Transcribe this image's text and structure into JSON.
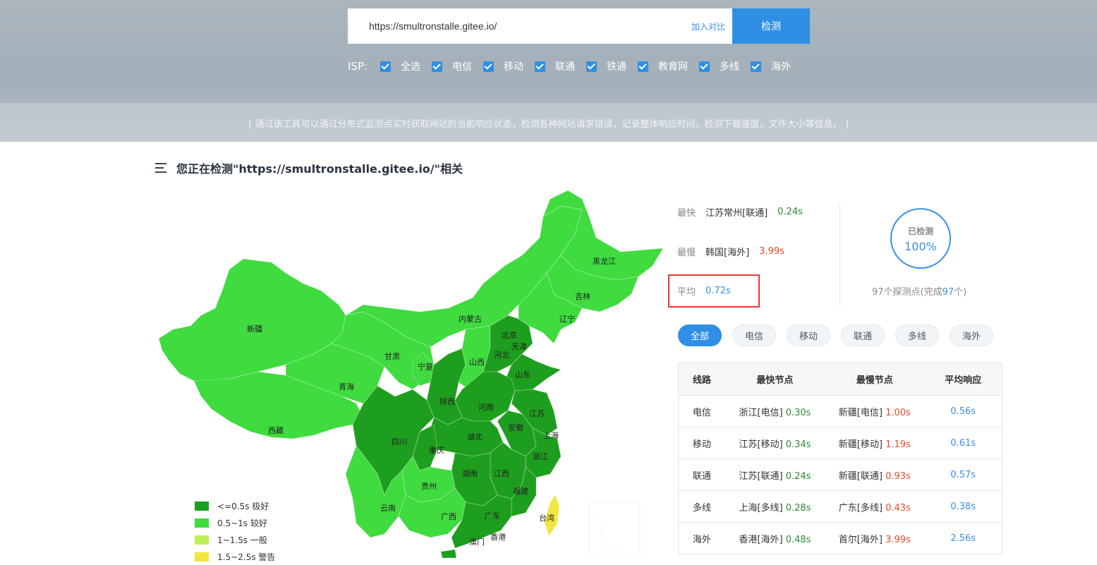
{
  "search": {
    "url_value": "https://smultronstalle.gitee.io/",
    "compare_label": "加入对比",
    "submit_label": "检测"
  },
  "isp_filter": {
    "label": "ISP:",
    "options": [
      "全选",
      "电信",
      "移动",
      "联通",
      "铁通",
      "教育网",
      "多线",
      "海外"
    ]
  },
  "notice": "[ 通过该工具可以通过分布式监测点实时获取网站的当前响应状态，检测各种网站请求错误，记录整体响应时间，检测下载速度，文件大小等信息。 ]",
  "section_title": "您正在检测\"https://smultronstalle.gitee.io/\"相关",
  "map": {
    "provinces": [
      "新疆",
      "西藏",
      "青海",
      "甘肃",
      "内蒙古",
      "黑龙江",
      "吉林",
      "辽宁",
      "北京",
      "天津",
      "河北",
      "宁夏",
      "山西",
      "山东",
      "陕西",
      "河南",
      "江苏",
      "上海",
      "安徽",
      "四川",
      "重庆",
      "湖北",
      "浙江",
      "湖南",
      "江西",
      "贵州",
      "福建",
      "云南",
      "广西",
      "广东",
      "台湾",
      "香港",
      "澳门"
    ],
    "legend": [
      {
        "label": "<=0.5s 极好",
        "color": "#1e9e1e"
      },
      {
        "label": "0.5~1s 较好",
        "color": "#3fdb3f"
      },
      {
        "label": "1~1.5s 一般",
        "color": "#bdf05a"
      },
      {
        "label": "1.5~2.5s 警告",
        "color": "#f4e640"
      }
    ]
  },
  "summary": {
    "fastest": {
      "label": "最快",
      "node": "江苏常州[联通]",
      "value": "0.24s"
    },
    "slowest": {
      "label": "最慢",
      "node": "韩国[海外]",
      "value": "3.99s"
    },
    "average": {
      "label": "平均",
      "value": "0.72s"
    },
    "progress_label": "已检测",
    "progress_value": "100%",
    "nodes_prefix": "97个探测点(完成",
    "nodes_done": "97",
    "nodes_suffix": "个)"
  },
  "tabs": [
    "全部",
    "电信",
    "移动",
    "联通",
    "多线",
    "海外"
  ],
  "table": {
    "headers": [
      "线路",
      "最快节点",
      "最慢节点",
      "平均响应"
    ],
    "rows": [
      {
        "line": "电信",
        "fast_node": "浙江[电信]",
        "fast_val": "0.30s",
        "slow_node": "新疆[电信]",
        "slow_val": "1.00s",
        "avg": "0.56s"
      },
      {
        "line": "移动",
        "fast_node": "江苏[移动]",
        "fast_val": "0.34s",
        "slow_node": "新疆[移动]",
        "slow_val": "1.19s",
        "avg": "0.61s"
      },
      {
        "line": "联通",
        "fast_node": "江苏[联通]",
        "fast_val": "0.24s",
        "slow_node": "新疆[联通]",
        "slow_val": "0.93s",
        "avg": "0.57s"
      },
      {
        "line": "多线",
        "fast_node": "上海[多线]",
        "fast_val": "0.28s",
        "slow_node": "广东[多线]",
        "slow_val": "0.43s",
        "avg": "0.38s"
      },
      {
        "line": "海外",
        "fast_node": "香港[海外]",
        "fast_val": "0.48s",
        "slow_node": "首尔[海外]",
        "slow_val": "3.99s",
        "avg": "2.56s"
      }
    ]
  }
}
